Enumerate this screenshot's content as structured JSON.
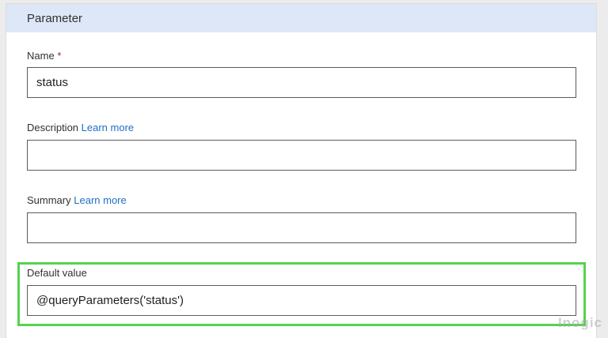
{
  "panel": {
    "title": "Parameter"
  },
  "fields": {
    "name": {
      "label": "Name",
      "required_mark": "*",
      "value": ""
    },
    "description": {
      "label": "Description",
      "learn_more": "Learn more",
      "value": ""
    },
    "summary": {
      "label": "Summary",
      "learn_more": "Learn more",
      "value": ""
    },
    "default_value": {
      "label": "Default value",
      "value": ""
    }
  },
  "input_values": {
    "name": "status",
    "default_value": "@queryParameters('status')"
  },
  "watermark": {
    "text": "Inogic"
  },
  "colors": {
    "header_bg": "#dde7f7",
    "link": "#1f6fc5",
    "required": "#a4262c",
    "highlight": "#56d24f"
  }
}
